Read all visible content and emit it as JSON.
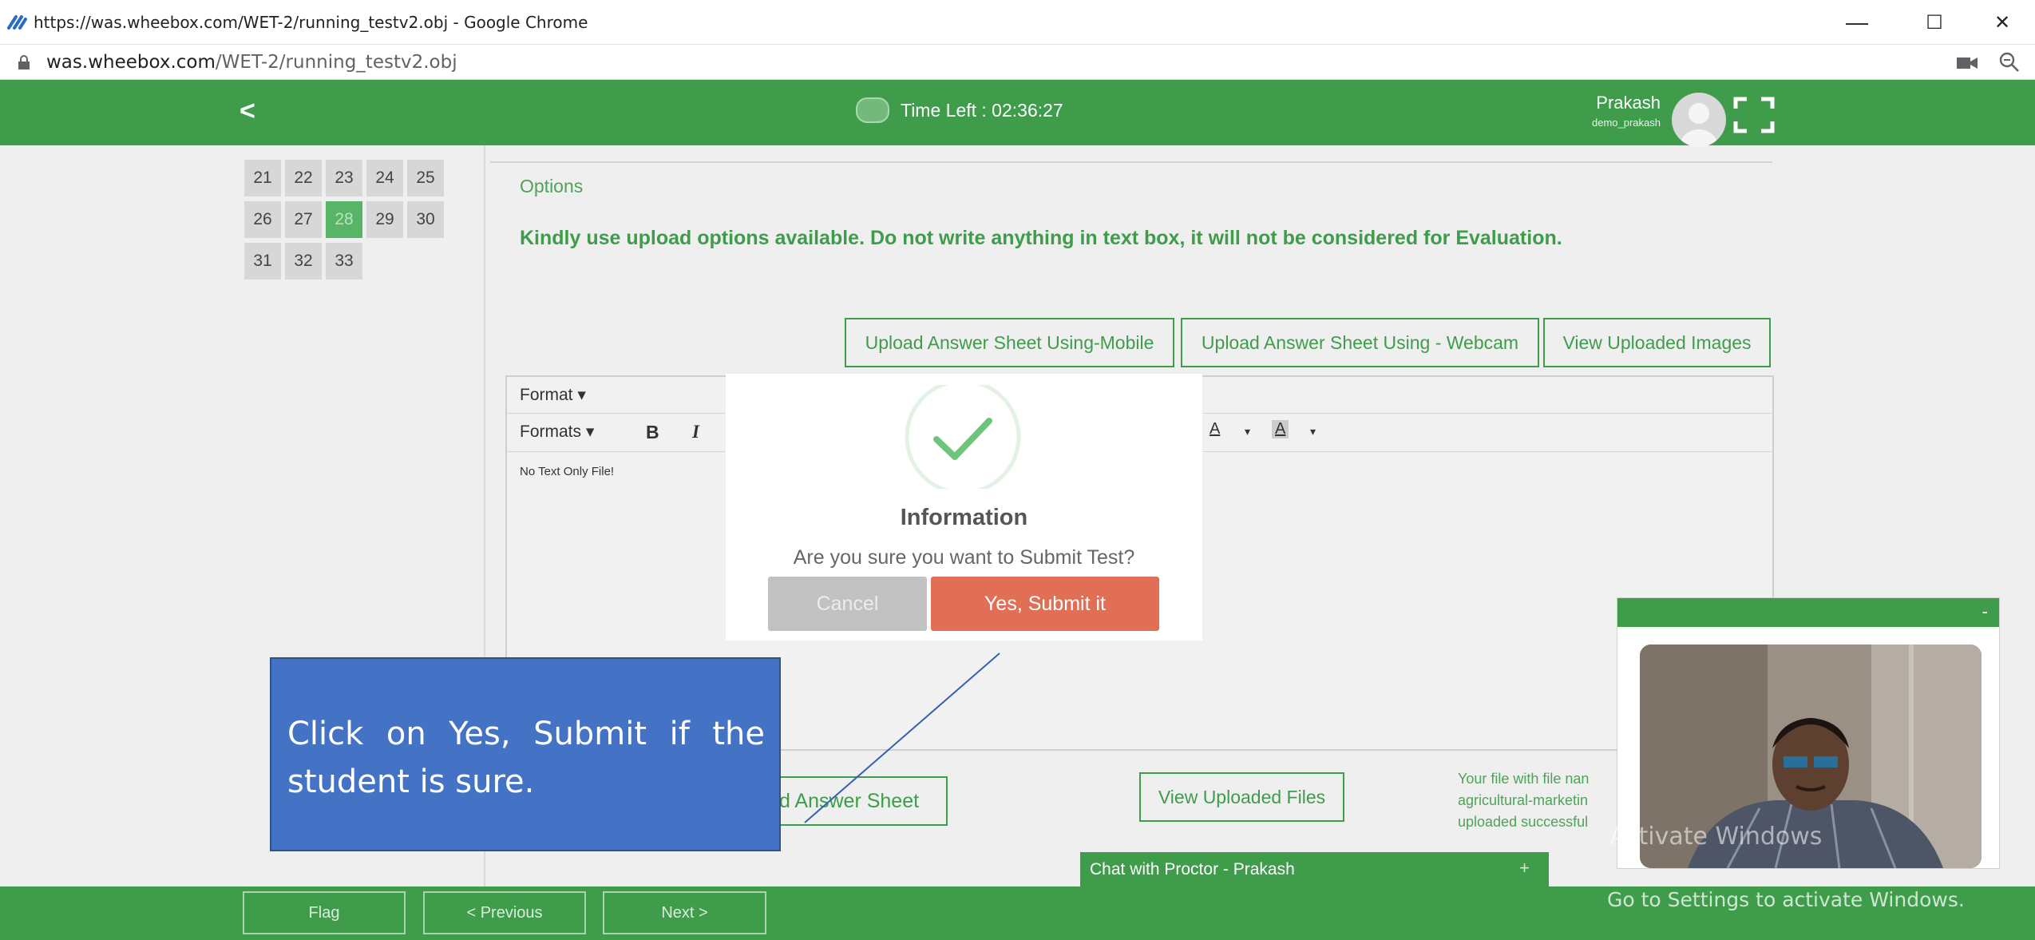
{
  "browser": {
    "window_title": "https://was.wheebox.com/WET-2/running_testv2.obj - Google Chrome",
    "url_host": "was.wheebox.com",
    "url_path": "/WET-2/running_testv2.obj",
    "minimize": "—",
    "maximize": "☐",
    "close": "✕"
  },
  "header": {
    "back": "<",
    "timer_label": "Time Left : 02:36:27",
    "user_name": "Prakash",
    "user_id": "demo_prakash"
  },
  "question_nav": {
    "items": [
      "21",
      "22",
      "23",
      "24",
      "25",
      "26",
      "27",
      "28",
      "29",
      "30",
      "31",
      "32",
      "33"
    ],
    "active": "28"
  },
  "main": {
    "options_label": "Options",
    "instruction": "Kindly use upload options available. Do not write anything in text box, it will not be considered for Evaluation.",
    "upload_mobile": "Upload Answer Sheet Using-Mobile",
    "upload_webcam": "Upload Answer Sheet Using - Webcam",
    "view_images": "View Uploaded Images"
  },
  "editor": {
    "format_menu": "Format ▾",
    "formats_menu": "Formats ▾",
    "bold": "B",
    "italic": "I",
    "font_color": "A",
    "bg_color": "A",
    "caret": "▾",
    "body_text": "No Text Only File!"
  },
  "bottom": {
    "upload_answer_sheet": "d Answer Sheet",
    "view_uploaded_files": "View Uploaded Files",
    "upload_note": [
      "Your file with file nan",
      "agricultural-marketin",
      "uploaded successful"
    ]
  },
  "modal": {
    "title": "Information",
    "message": "Are you sure you want to Submit Test?",
    "cancel": "Cancel",
    "confirm": "Yes, Submit it"
  },
  "callout": {
    "text": "Click on Yes, Submit if the student is sure."
  },
  "webcam": {
    "minimize": "-"
  },
  "chat": {
    "label": "Chat with Proctor - Prakash",
    "expand": "+"
  },
  "footer": {
    "flag": "Flag",
    "previous": "< Previous",
    "next": "Next >"
  },
  "windows_watermark": {
    "line1": "Activate Windows",
    "line2": "Go to Settings to activate Windows."
  },
  "colors": {
    "brand_green": "#3e9c4b",
    "confirm_red": "#e06f55",
    "callout_blue": "#4472c4"
  }
}
